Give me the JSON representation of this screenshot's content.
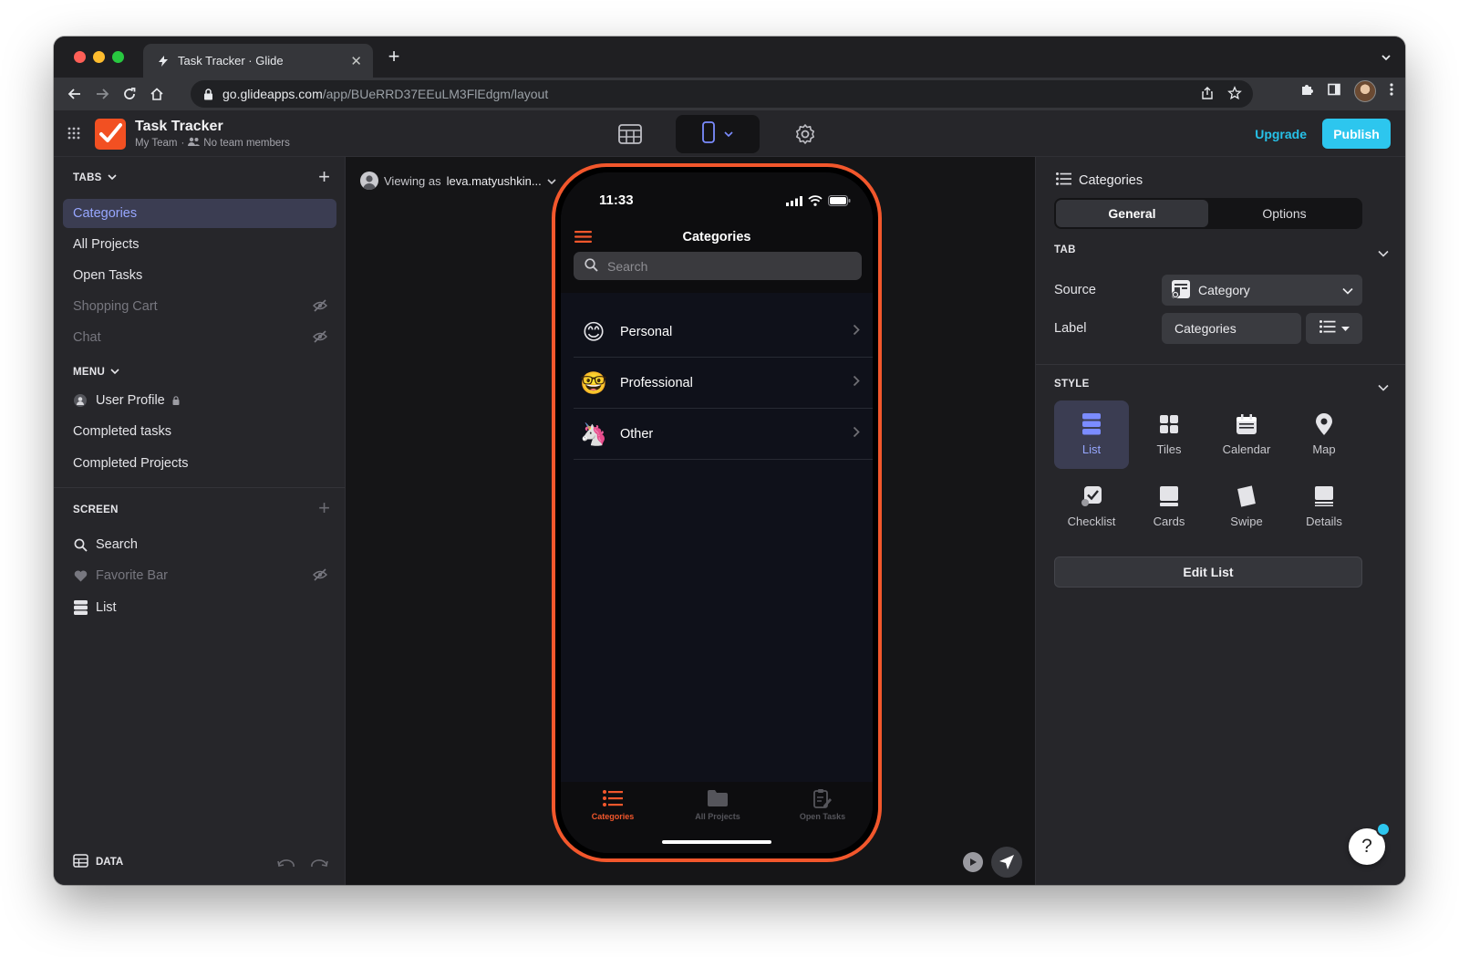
{
  "browser": {
    "tab_title": "Task Tracker · Glide",
    "url_host": "go.glideapps.com",
    "url_path": "/app/BUeRRD37EEuLM3FlEdgm/layout"
  },
  "app": {
    "name": "Task Tracker",
    "team": "My Team",
    "team_separator": "·",
    "members": "No team members",
    "upgrade_label": "Upgrade",
    "publish_label": "Publish",
    "logo_color": "#f25022",
    "accent_color": "#2dc6ee"
  },
  "sidebar": {
    "tabs_header": "TABS",
    "tabs": [
      {
        "label": "Categories",
        "active": true,
        "hidden": false
      },
      {
        "label": "All Projects",
        "active": false,
        "hidden": false
      },
      {
        "label": "Open Tasks",
        "active": false,
        "hidden": false
      },
      {
        "label": "Shopping Cart",
        "active": false,
        "hidden": true
      },
      {
        "label": "Chat",
        "active": false,
        "hidden": true
      }
    ],
    "menu_header": "MENU",
    "menu": [
      {
        "label": "User Profile",
        "icon": "user-icon",
        "locked": true
      },
      {
        "label": "Completed tasks"
      },
      {
        "label": "Completed Projects"
      }
    ],
    "screen_header": "SCREEN",
    "screen": [
      {
        "label": "Search",
        "icon": "search-icon",
        "hidden": false
      },
      {
        "label": "Favorite Bar",
        "icon": "heart-icon",
        "hidden": true
      },
      {
        "label": "List",
        "icon": "list-icon",
        "hidden": false
      }
    ],
    "data_label": "DATA"
  },
  "canvas": {
    "viewing_prefix": "Viewing as",
    "viewing_user": "leva.matyushkin..."
  },
  "phone": {
    "time": "11:33",
    "title": "Categories",
    "search_placeholder": "Search",
    "items": [
      {
        "emoji": "😊",
        "label": "Personal"
      },
      {
        "emoji": "🤓",
        "label": "Professional"
      },
      {
        "emoji": "🦄",
        "label": "Other"
      }
    ],
    "tabs": [
      {
        "label": "Categories",
        "active": true
      },
      {
        "label": "All Projects",
        "active": false
      },
      {
        "label": "Open Tasks",
        "active": false
      }
    ],
    "frame_color": "#f2572c"
  },
  "panel": {
    "title": "Categories",
    "seg_general": "General",
    "seg_options": "Options",
    "tab_header": "TAB",
    "source_label": "Source",
    "source_value": "Category",
    "label_label": "Label",
    "label_value": "Categories",
    "style_header": "STYLE",
    "styles": [
      {
        "label": "List",
        "selected": true
      },
      {
        "label": "Tiles",
        "selected": false
      },
      {
        "label": "Calendar",
        "selected": false
      },
      {
        "label": "Map",
        "selected": false
      },
      {
        "label": "Checklist",
        "selected": false
      },
      {
        "label": "Cards",
        "selected": false
      },
      {
        "label": "Swipe",
        "selected": false
      },
      {
        "label": "Details",
        "selected": false
      }
    ],
    "edit_button": "Edit List",
    "help_label": "?"
  }
}
